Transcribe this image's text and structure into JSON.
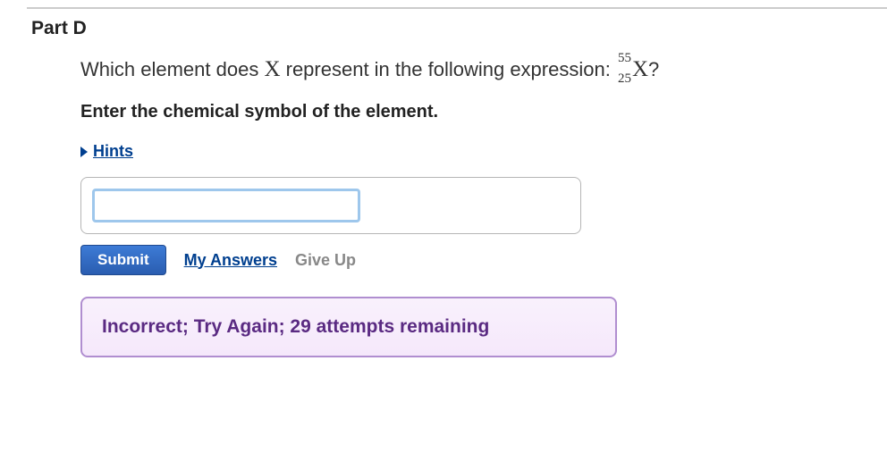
{
  "part_title": "Part D",
  "question": {
    "prefix": "Which element does ",
    "var": "X",
    "middle": " represent in the following expression: ",
    "mass": "55",
    "atomic": "25",
    "sym": "X",
    "suffix": "?"
  },
  "instruction": "Enter the chemical symbol of the element.",
  "hints_label": "Hints",
  "answer_value": "",
  "submit_label": "Submit",
  "my_answers_label": "My Answers",
  "giveup_label": "Give Up",
  "feedback": "Incorrect; Try Again; 29 attempts remaining"
}
